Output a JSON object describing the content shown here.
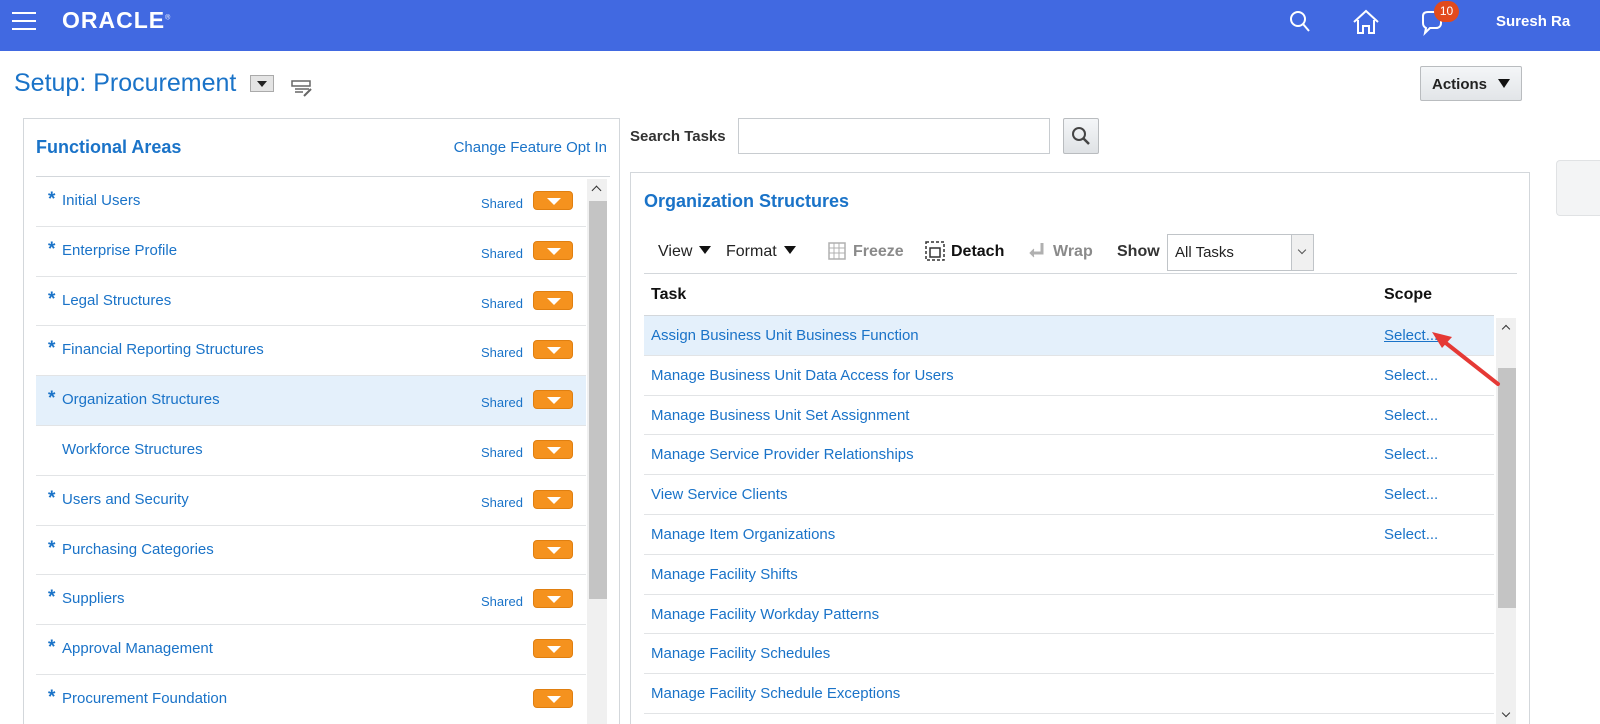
{
  "topbar": {
    "logo": "ORACLE",
    "logo_mark": "®",
    "notification_count": "10",
    "user": "Suresh Ra",
    "brand_color": "#4169e1",
    "icons": [
      "menu-icon",
      "search-icon",
      "home-icon",
      "notifications-icon"
    ]
  },
  "page": {
    "title": "Setup: Procurement"
  },
  "actions": {
    "label": "Actions"
  },
  "functional_areas": {
    "title": "Functional Areas",
    "change_link": "Change Feature Opt In",
    "items": [
      {
        "required": "*",
        "label": "Initial Users",
        "shared": "Shared"
      },
      {
        "required": "*",
        "label": "Enterprise Profile",
        "shared": "Shared"
      },
      {
        "required": "*",
        "label": "Legal Structures",
        "shared": "Shared"
      },
      {
        "required": "*",
        "label": "Financial Reporting Structures",
        "shared": "Shared"
      },
      {
        "required": "*",
        "label": "Organization Structures",
        "shared": "Shared",
        "selected": true
      },
      {
        "required": "",
        "label": "Workforce Structures",
        "shared": "Shared"
      },
      {
        "required": "*",
        "label": "Users and Security",
        "shared": "Shared"
      },
      {
        "required": "*",
        "label": "Purchasing Categories",
        "shared": ""
      },
      {
        "required": "*",
        "label": "Suppliers",
        "shared": "Shared"
      },
      {
        "required": "*",
        "label": "Approval Management",
        "shared": ""
      },
      {
        "required": "*",
        "label": "Procurement Foundation",
        "shared": ""
      }
    ]
  },
  "search": {
    "label": "Search Tasks",
    "value": "",
    "placeholder": ""
  },
  "org_structures": {
    "title": "Organization Structures",
    "toolbar": {
      "view": "View",
      "format": "Format",
      "freeze": "Freeze",
      "detach": "Detach",
      "wrap": "Wrap",
      "show_label": "Show",
      "show_value": "All Tasks"
    },
    "columns": {
      "task": "Task",
      "scope": "Scope"
    },
    "tasks": [
      {
        "name": "Assign Business Unit Business Function",
        "scope": "Select...",
        "selected": true
      },
      {
        "name": "Manage Business Unit Data Access for Users",
        "scope": "Select..."
      },
      {
        "name": "Manage Business Unit Set Assignment",
        "scope": "Select..."
      },
      {
        "name": "Manage Service Provider Relationships",
        "scope": "Select..."
      },
      {
        "name": "View Service Clients",
        "scope": "Select..."
      },
      {
        "name": "Manage Item Organizations",
        "scope": "Select..."
      },
      {
        "name": "Manage Facility Shifts",
        "scope": ""
      },
      {
        "name": "Manage Facility Workday Patterns",
        "scope": ""
      },
      {
        "name": "Manage Facility Schedules",
        "scope": ""
      },
      {
        "name": "Manage Facility Schedule Exceptions",
        "scope": ""
      }
    ]
  },
  "colors": {
    "link": "#1a73c8",
    "selected_row": "#e4f0fb",
    "dropdown_accent": "#f5921e",
    "badge": "#e24a1c",
    "annotation_arrow": "#e53935"
  }
}
